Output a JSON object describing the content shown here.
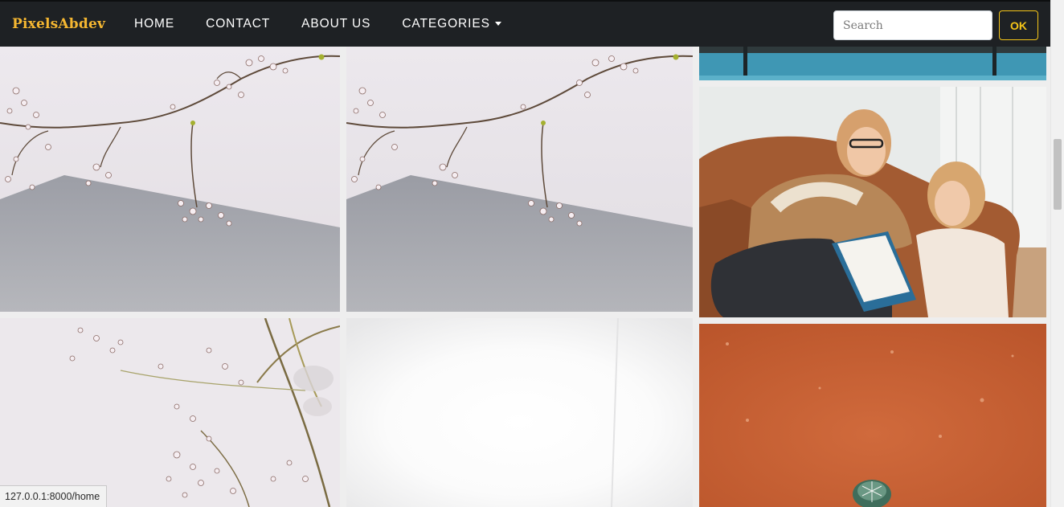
{
  "navbar": {
    "brand": "PixelsAbdev",
    "links": [
      "HOME",
      "CONTACT",
      "ABOUT US",
      "CATEGORIES"
    ],
    "search_placeholder": "Search",
    "search_button": "OK"
  },
  "status_bar": {
    "url": "127.0.0.1:8000/home"
  },
  "colors": {
    "navbar_bg": "#1e2124",
    "brand": "#f5b731",
    "button_accent": "#f5c518"
  }
}
